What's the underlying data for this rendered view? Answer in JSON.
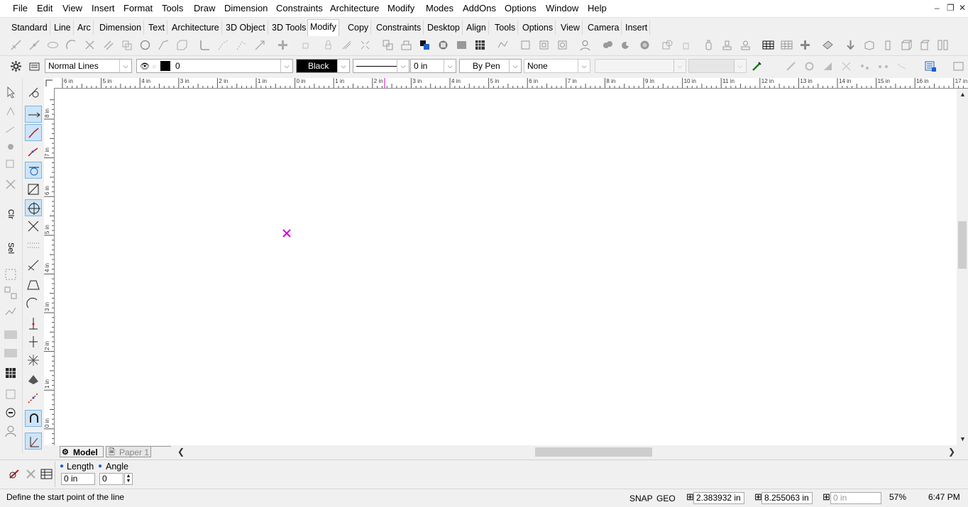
{
  "menubar": {
    "items": [
      "File",
      "Edit",
      "View",
      "Insert",
      "Format",
      "Tools",
      "Draw",
      "Dimension",
      "Constraints",
      "Architecture",
      "Modify",
      "Modes",
      "AddOns",
      "Options",
      "Window",
      "Help"
    ]
  },
  "toolbar_tabs": {
    "items": [
      "Standard",
      "Line",
      "Arc",
      "Dimension",
      "Text",
      "Architecture",
      "3D Object",
      "3D Tools",
      "Modify",
      "Copy",
      "Constraints",
      "Desktop",
      "Align",
      "Tools",
      "Options",
      "View",
      "Camera",
      "Insert"
    ],
    "active": "Modify"
  },
  "properties": {
    "line_style": "Normal Lines",
    "layer": "0",
    "color_name": "Black",
    "color_hex": "#000000",
    "line_weight": "0 in",
    "pen": "By Pen",
    "fill": "None"
  },
  "ruler": {
    "h_labels": [
      "6 in",
      "5 in",
      "4 in",
      "3 in",
      "2 in",
      "1 in",
      "0 in",
      "1 in",
      "2 in",
      "3 in",
      "4 in",
      "5 in",
      "6 in",
      "7 in",
      "8 in",
      "9 in",
      "10 in",
      "11 in",
      "12 in",
      "13 in",
      "14 in",
      "15 in",
      "16 in",
      "17 in"
    ],
    "v_labels": [
      "8 in",
      "7 in",
      "6 in",
      "5 in",
      "4 in",
      "3 in",
      "2 in",
      "1 in",
      "0 in"
    ]
  },
  "left_palette": {
    "labels": [
      "Clr",
      "Sel"
    ]
  },
  "sheets": {
    "model": "Model",
    "paper": "Paper 1"
  },
  "inspector": {
    "length_label": "Length",
    "angle_label": "Angle",
    "length_value": "0 in",
    "angle_value": "0"
  },
  "status": {
    "prompt": "Define the start point of the line",
    "snap": "SNAP",
    "geo": "GEO",
    "x_value": "2.383932 in",
    "y_value": "8.255063 in",
    "z_placeholder": "0 in",
    "zoom": "57%",
    "time": "6:47 PM"
  },
  "colors": {
    "accent_magenta": "#d400d4",
    "selected_tool_bg": "#cce4f7",
    "blue_icon": "#1e5fc8"
  }
}
